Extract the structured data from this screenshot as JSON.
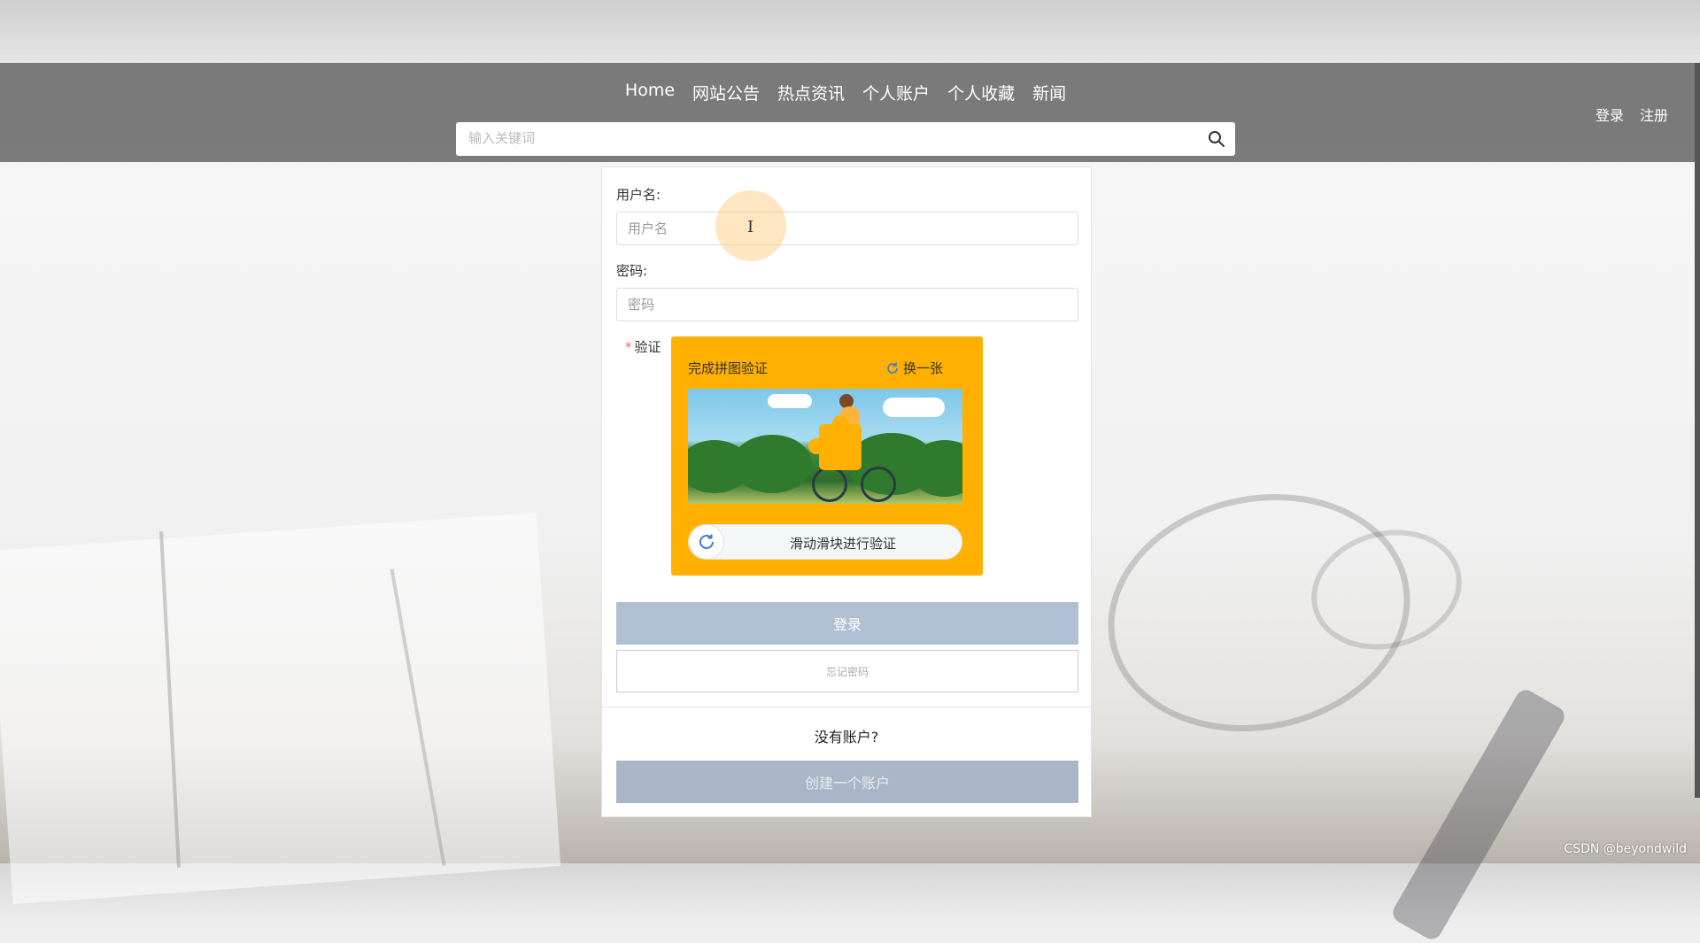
{
  "header": {
    "nav": [
      "Home",
      "网站公告",
      "热点资讯",
      "个人账户",
      "个人收藏",
      "新闻"
    ],
    "auth": {
      "login": "登录",
      "register": "注册"
    },
    "search": {
      "placeholder": "输入关键词",
      "icon": "search-icon"
    }
  },
  "form": {
    "username_label": "用户名:",
    "username_placeholder": "用户名",
    "password_label": "密码:",
    "password_placeholder": "密码",
    "verify_label": "验证",
    "required_mark": "*"
  },
  "captcha": {
    "title": "完成拼图验证",
    "refresh_label": "换一张",
    "slider_text": "滑动滑块进行验证",
    "background_color": "#ffb000"
  },
  "buttons": {
    "login": "登录",
    "forgot": "忘记密码",
    "no_account": "没有账户?",
    "create": "创建一个账户"
  },
  "watermark": "CSDN @beyondwild"
}
